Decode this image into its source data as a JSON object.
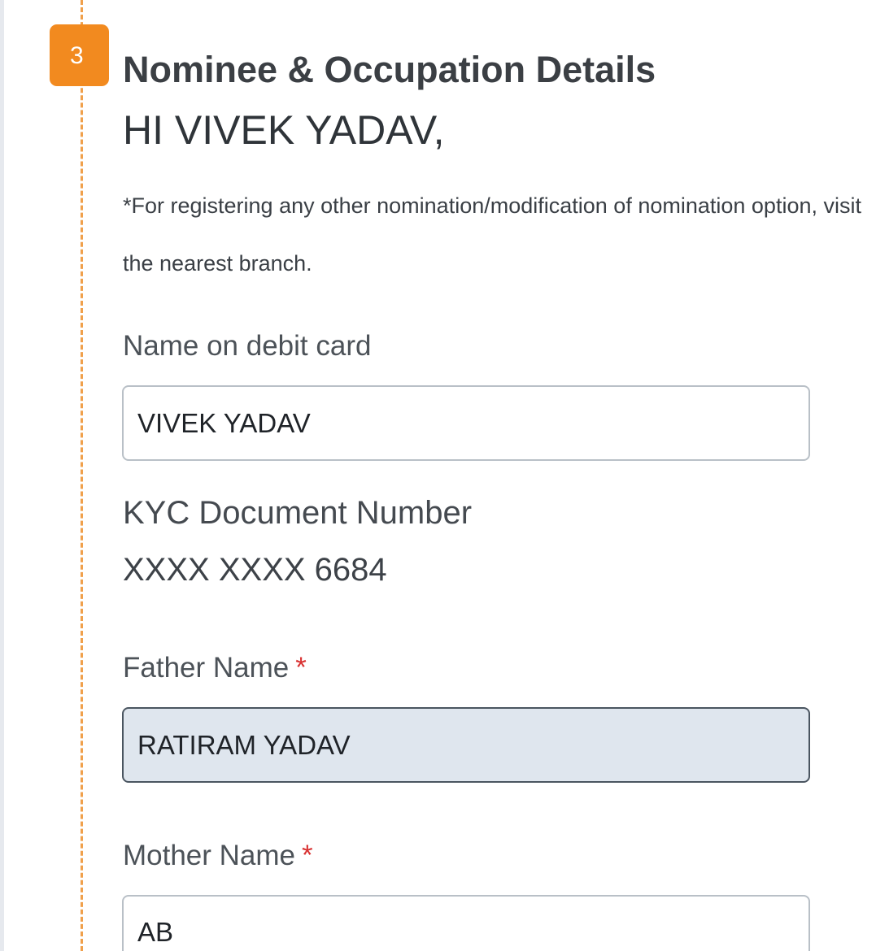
{
  "step": {
    "number": "3",
    "title": "Nominee & Occupation Details"
  },
  "greeting": "HI VIVEK YADAV,",
  "note": "*For registering any other nomination/modification of nomination option, visit the nearest branch.",
  "fields": {
    "debit_card_name": {
      "label": "Name on debit card",
      "value": "VIVEK YADAV"
    },
    "kyc": {
      "label": "KYC Document Number",
      "value": "XXXX XXXX 6684"
    },
    "father_name": {
      "label": "Father Name",
      "required_mark": "*",
      "value": "RATIRAM YADAV"
    },
    "mother_name": {
      "label": "Mother Name",
      "required_mark": "*",
      "value": "AB"
    }
  },
  "colors": {
    "accent": "#f28a1f",
    "stepper_line": "#f0a04b",
    "required": "#d93232",
    "filled_field_bg": "#dfe6ee"
  }
}
